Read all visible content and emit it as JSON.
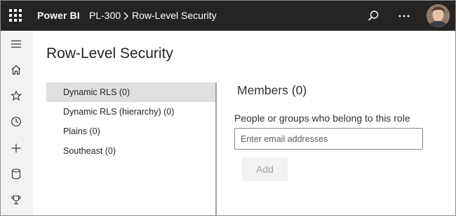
{
  "header": {
    "app_name": "Power BI",
    "breadcrumb": [
      "PL-300",
      "Row-Level Security"
    ],
    "icons": [
      "app-launcher-icon",
      "search-icon",
      "more-options-icon",
      "user-avatar"
    ]
  },
  "nav_rail": {
    "items": [
      "hamburger-menu-icon",
      "home-icon",
      "favorites-star-icon",
      "recent-clock-icon",
      "create-plus-icon",
      "datasets-cylinder-icon",
      "goals-trophy-icon"
    ]
  },
  "page": {
    "title": "Row-Level Security"
  },
  "roles": [
    {
      "label": "Dynamic RLS (0)",
      "selected": true
    },
    {
      "label": "Dynamic RLS (hierarchy) (0)",
      "selected": false
    },
    {
      "label": "Plains (0)",
      "selected": false
    },
    {
      "label": "Southeast (0)",
      "selected": false
    }
  ],
  "members": {
    "title": "Members (0)",
    "label": "People or groups who belong to this role",
    "input_placeholder": "Enter email addresses",
    "input_value": "",
    "add_label": "Add"
  },
  "colors": {
    "header_bg": "#252423",
    "rail_bg": "#f3f2f1",
    "selected_role_bg": "#e1dfdd"
  }
}
